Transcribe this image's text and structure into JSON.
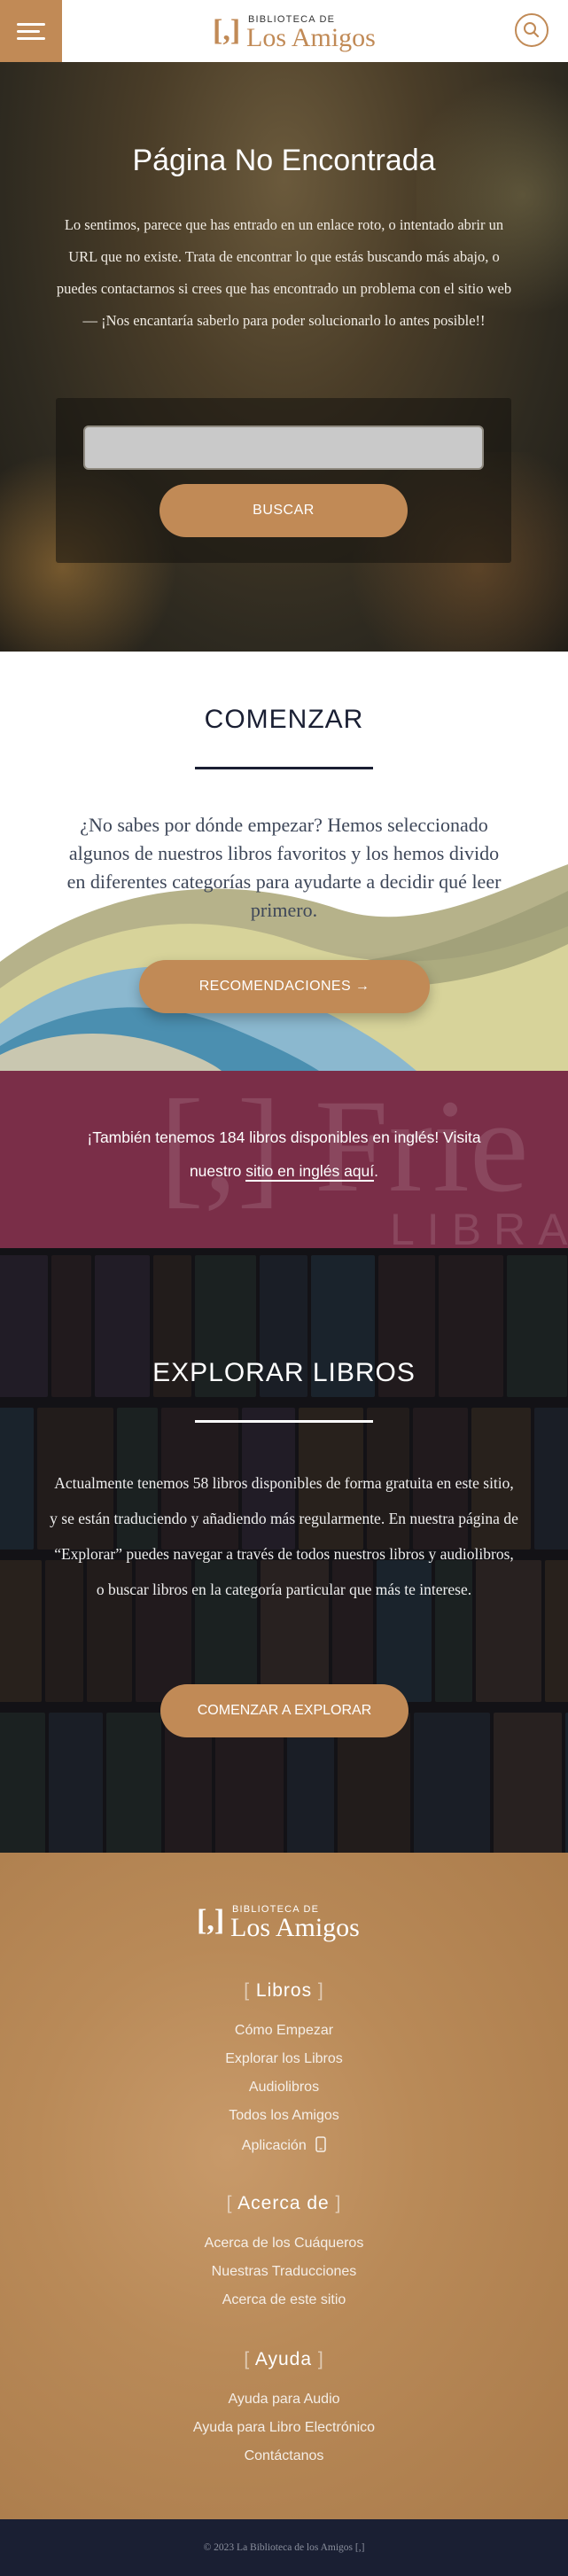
{
  "header": {
    "logo_glyph": "[,]",
    "logo_pre": "BIBLIOTECA DE",
    "logo_name": "Los Amigos",
    "menu_icon": "hamburger-icon",
    "search_icon": "magnifier-icon",
    "accent": "#c18a56"
  },
  "hero": {
    "title": "Página No Encontrada",
    "intro": "Lo sentimos, parece que has entrado en un enlace roto, o intentado abrir un URL que no existe. Trata de encontrar lo que estás buscando más abajo, o puedes contactarnos si crees que has encontrado un problema con el sitio web — ¡Nos encantaría saberlo para poder solucionarlo lo antes posible!!",
    "search_value": "",
    "search_button": "BUSCAR"
  },
  "comenzar": {
    "title": "COMENZAR",
    "lead": "¿No sabes por dónde empezar? Hemos seleccionado algunos de nuestros libros favoritos y los hemos divido en diferentes categorías para ayudarte a decidir qué leer primero.",
    "button": "RECOMENDACIONES →"
  },
  "english": {
    "text_before": "¡También tenemos 184 libros disponibles en inglés! Visita nuestro ",
    "link": "sitio en inglés aquí",
    "text_after": ".",
    "bg_mark": "[,] Frie",
    "bg_sub": "LIBRA"
  },
  "explorar": {
    "title": "EXPLORAR LIBROS",
    "desc": "Actualmente tenemos 58 libros disponibles de forma gratuita en este sitio, y se están traduciendo y añadiendo más regularmente. En nuestra página de “Explorar” puedes navegar a través de todos nuestros libros y audiolibros, o buscar libros en la categoría particular que más te interese.",
    "button": "COMENZAR A EXPLORAR"
  },
  "footer": {
    "logo_glyph": "[,]",
    "logo_pre": "BIBLIOTECA DE",
    "logo_name": "Los Amigos",
    "sections": [
      {
        "title": "Libros",
        "links": [
          "Cómo Empezar",
          "Explorar los Libros",
          "Audiolibros",
          "Todos los Amigos",
          "Aplicación"
        ]
      },
      {
        "title": "Acerca de",
        "links": [
          "Acerca de los Cuáqueros",
          "Nuestras Traducciones",
          "Acerca de este sitio"
        ]
      },
      {
        "title": "Ayuda",
        "links": [
          "Ayuda para Audio",
          "Ayuda para Libro Electrónico",
          "Contáctanos"
        ]
      }
    ],
    "copyright": "© 2023 La Biblioteca de los Amigos [,]"
  }
}
